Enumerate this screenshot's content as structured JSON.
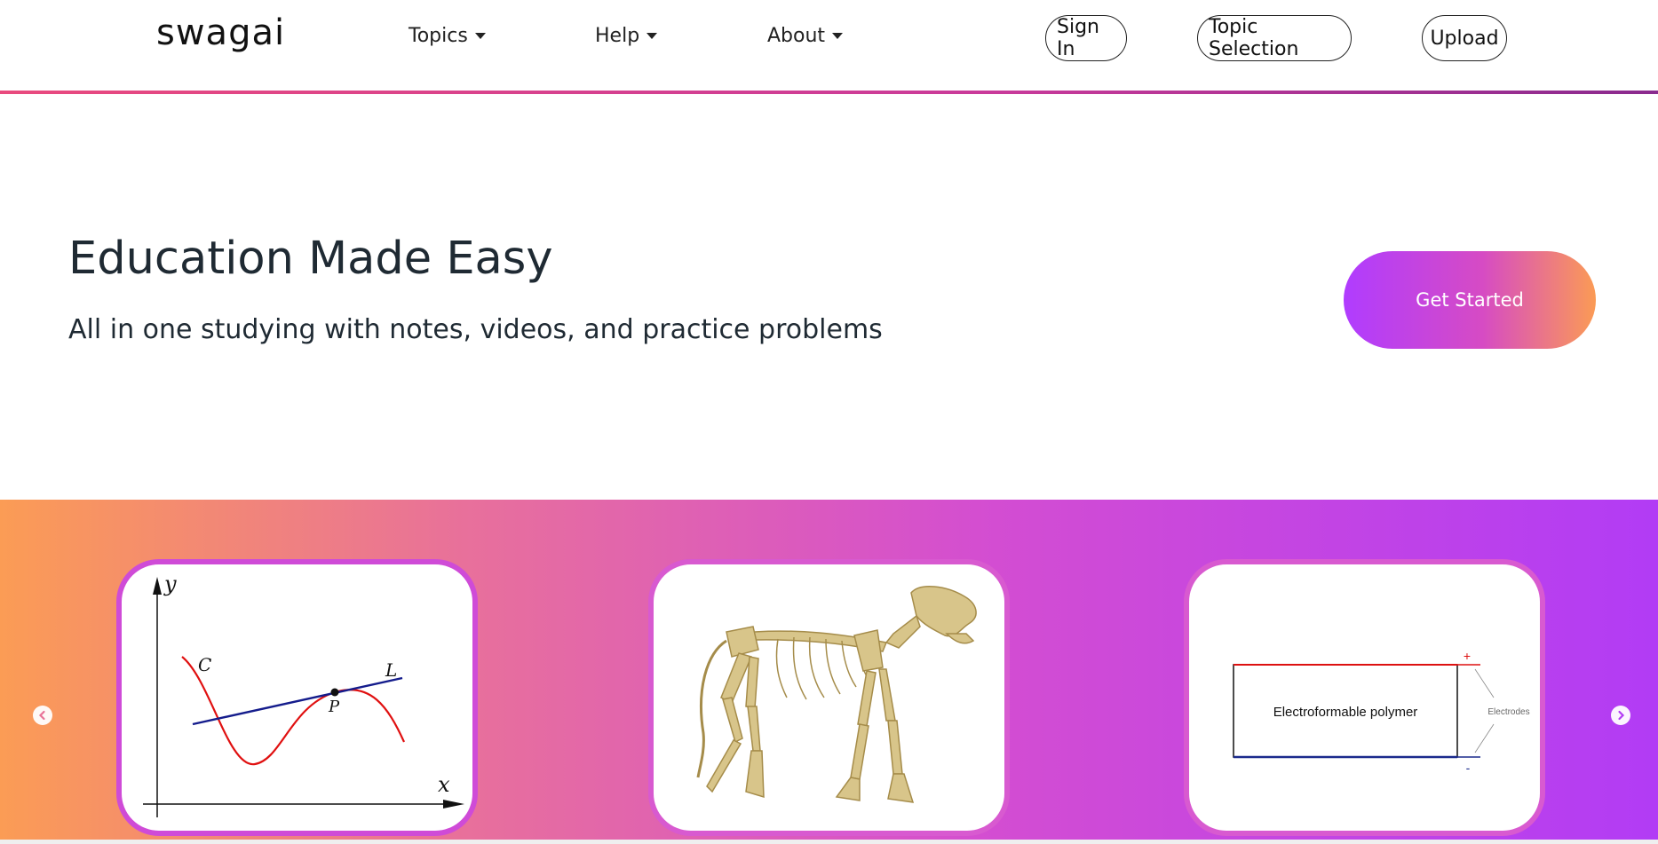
{
  "navbar": {
    "brand": "swagai",
    "menus": [
      {
        "label": "Topics"
      },
      {
        "label": "Help"
      },
      {
        "label": "About"
      }
    ],
    "buttons": {
      "sign_in": "Sign In",
      "topic_selection": "Topic Selection",
      "upload": "Upload"
    }
  },
  "hero": {
    "title": "Education Made Easy",
    "subtitle": "All in one studying with notes, videos, and practice problems",
    "cta": "Get Started"
  },
  "carousel": {
    "cards": [
      {
        "name": "calculus-tangent-graph",
        "labels": {
          "y": "y",
          "x": "x",
          "c": "C",
          "l": "L",
          "p": "P"
        }
      },
      {
        "name": "animal-skeleton"
      },
      {
        "name": "electroformable-polymer",
        "labels": {
          "main": "Electroformable polymer",
          "electrodes": "Electrodes",
          "plus": "+",
          "minus": "-"
        }
      }
    ]
  },
  "colors": {
    "brand_gradient_start": "#b03cff",
    "brand_gradient_end": "#fb9b55",
    "nav_line": "#e94a7e"
  }
}
